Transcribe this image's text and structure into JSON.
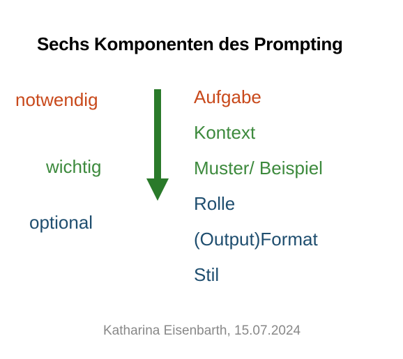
{
  "title": "Sechs Komponenten des Prompting",
  "leftLabels": {
    "notwendig": "notwendig",
    "wichtig": "wichtig",
    "optional": "optional"
  },
  "rightItems": {
    "aufgabe": "Aufgabe",
    "kontext": "Kontext",
    "muster": "Muster/ Beispiel",
    "rolle": "Rolle",
    "format": "(Output)Format",
    "stil": "Stil"
  },
  "footer": "Katharina Eisenbarth, 15.07.2024",
  "colors": {
    "notwendig": "#c8491b",
    "wichtig": "#3d8a3d",
    "optional": "#1f4e6f",
    "arrow": "#2a7a2a"
  }
}
